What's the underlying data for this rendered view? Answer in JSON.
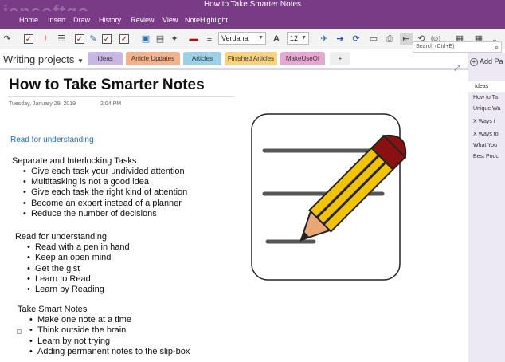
{
  "window": {
    "title": "How to Take Smarter Notes",
    "watermark": "jensoftgo"
  },
  "menu": [
    {
      "label": "Home"
    },
    {
      "label": "Insert"
    },
    {
      "label": "Draw"
    },
    {
      "label": "History"
    },
    {
      "label": "Review"
    },
    {
      "label": "View"
    },
    {
      "label": "NoteHighlight"
    }
  ],
  "ribbon": {
    "font_name": "Verdana",
    "font_size": "12"
  },
  "search": {
    "placeholder": "Search (Ctrl+E)"
  },
  "notebook": {
    "name": "Writing projects",
    "dropdown_icon": "chevron-down-icon"
  },
  "section_tabs": [
    {
      "label": "Ideas",
      "color": "#c9b7e3"
    },
    {
      "label": "Article Updates",
      "color": "#f2b28c"
    },
    {
      "label": "Articles",
      "color": "#9bd0e6"
    },
    {
      "label": "Finished Articles",
      "color": "#f8d27e"
    },
    {
      "label": "MakeUseOf",
      "color": "#e6a8d1"
    },
    {
      "label": "+"
    }
  ],
  "pages_panel": {
    "add_page": "Add Pa",
    "pages": [
      {
        "label": "Ideas"
      },
      {
        "label": "How to Ta"
      },
      {
        "label": "Unique Wa"
      },
      {
        "label": "X Ways t"
      },
      {
        "label": "X Ways to"
      },
      {
        "label": "What You"
      },
      {
        "label": "Best Podc"
      }
    ]
  },
  "page": {
    "title": "How to Take Smarter Notes",
    "date": "Tuesday, January 29, 2019",
    "time": "2:04 PM",
    "link": "Read for understanding",
    "sections": [
      {
        "heading": "Separate and Interlocking Tasks",
        "items": [
          "Give each task your undivided attention",
          "Multitasking is not a good idea",
          "Give each task the right kind of attention",
          "Become an expert instead of a planner",
          "Reduce the number of decisions"
        ]
      },
      {
        "heading": "Read for understanding",
        "items": [
          "Read with a pen in hand",
          "Keep an open mind",
          "Get the gist",
          "Learn to Read",
          "Learn by Reading"
        ]
      },
      {
        "heading": "Take Smart Notes",
        "items": [
          "Make one note at a time",
          "Think outside the brain",
          "Learn by not trying",
          "Adding permanent notes to the slip-box"
        ]
      }
    ]
  },
  "colors": {
    "accent": "#7a3b86",
    "link": "#1f6fb6"
  }
}
